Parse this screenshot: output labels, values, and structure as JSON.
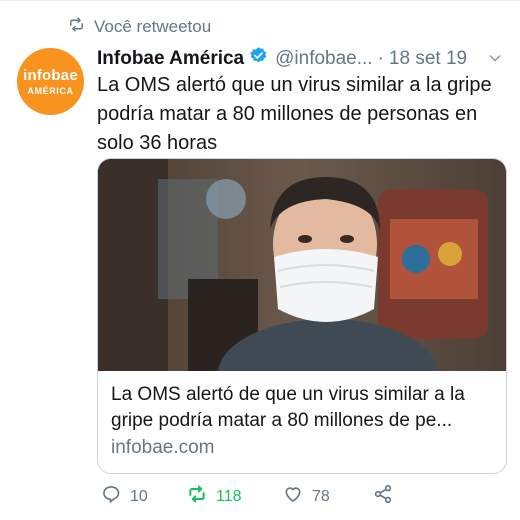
{
  "retweet": {
    "label": "Você retweetou"
  },
  "author": {
    "avatar_line1": "infobae",
    "avatar_line2": "AMÉRICA",
    "name": "Infobae América",
    "handle": "@infobae...",
    "date": "18 set 19"
  },
  "tweet": {
    "text": "La OMS alertó que un virus similar a la gripe podría matar a 80 millones de personas en solo 36 horas"
  },
  "card": {
    "title": "La OMS alertó de que un virus similar a la gripe podría matar a 80 millones de pe...",
    "domain": "infobae.com"
  },
  "actions": {
    "reply_count": "10",
    "retweet_count": "118",
    "like_count": "78"
  },
  "colors": {
    "accent": "#1da1f2",
    "retweet_active": "#17bf63",
    "muted": "#657786",
    "brand": "#f7931e"
  },
  "icons": [
    "retweet-icon",
    "verified-badge-icon",
    "chevron-down-icon",
    "reply-icon",
    "like-icon",
    "share-icon"
  ]
}
